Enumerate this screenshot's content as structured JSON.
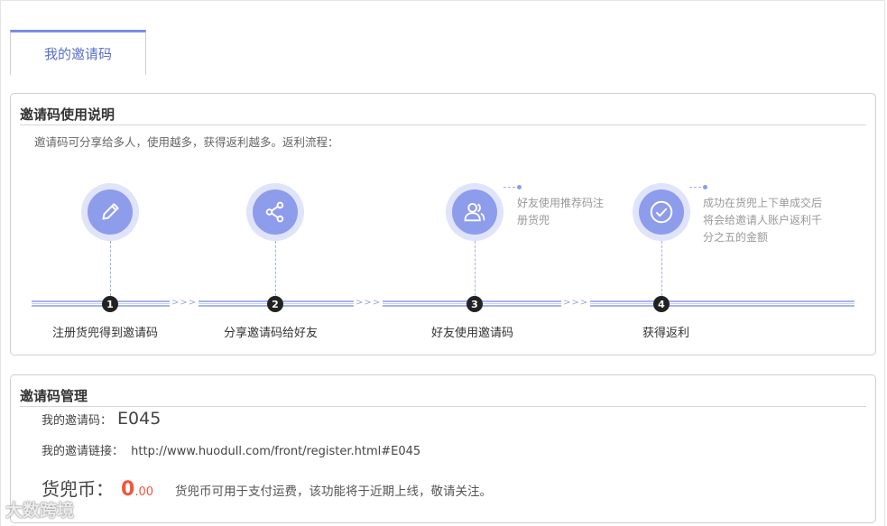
{
  "tab": {
    "label": "我的邀请码"
  },
  "usage": {
    "title": "邀请码使用说明",
    "intro": "邀请码可分享给多人，使用越多，获得返利越多。返利流程：",
    "chevron": ">>>",
    "steps": [
      {
        "num": "1",
        "label": "注册货兜得到邀请码",
        "icon": "pencil-icon"
      },
      {
        "num": "2",
        "label": "分享邀请码给好友",
        "icon": "share-icon"
      },
      {
        "num": "3",
        "label": "好友使用邀请码",
        "icon": "users-icon",
        "note": "好友使用推荐码注册货兜"
      },
      {
        "num": "4",
        "label": "获得返利",
        "icon": "check-circle-icon",
        "note": "成功在货兜上下单成交后将会给邀请人账户返利千分之五的金额"
      }
    ]
  },
  "management": {
    "title": "邀请码管理",
    "code_label": "我的邀请码：",
    "code_value": "E045",
    "link_label": "我的邀请链接：",
    "link_value": "http://www.huodull.com/front/register.html#E045",
    "coin_label": "货兜币：",
    "coin_int": "0",
    "coin_dec": ".00",
    "coin_desc": "货兜币可用于支付运费，该功能将于近期上线，敬请关注。"
  },
  "watermark": "大数跨境",
  "colors": {
    "accent": "#8e9cec",
    "coin": "#f0573a"
  }
}
